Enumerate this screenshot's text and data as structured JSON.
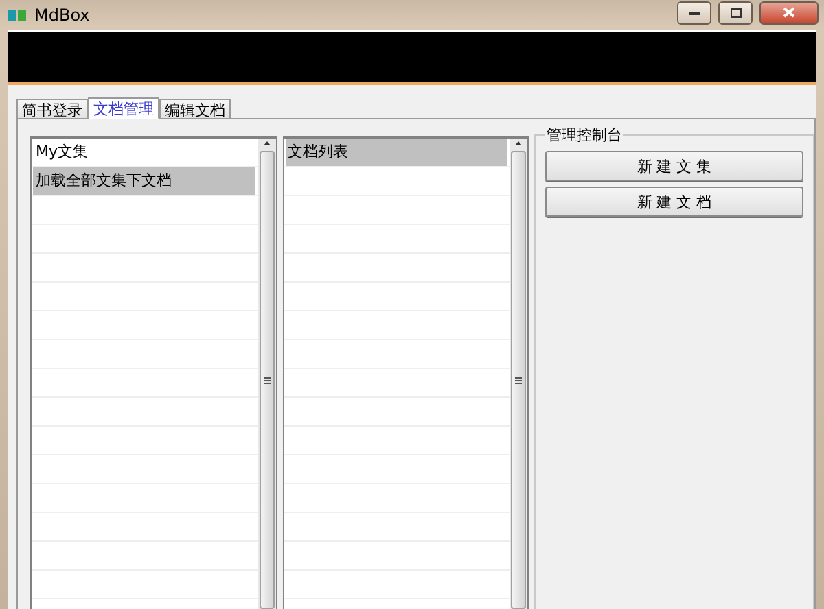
{
  "window": {
    "title": "MdBox"
  },
  "tabs": [
    {
      "label": "简书登录",
      "selected": false
    },
    {
      "label": "文档管理",
      "selected": true
    },
    {
      "label": "编辑文档",
      "selected": false
    }
  ],
  "collections_list": {
    "items": [
      {
        "label": "My文集",
        "selected": false
      },
      {
        "label": "加载全部文集下文档",
        "selected": true
      }
    ]
  },
  "documents_list": {
    "items": [
      {
        "label": "文档列表",
        "selected": true
      }
    ]
  },
  "control_panel": {
    "title": "管理控制台",
    "buttons": [
      "新 建 文 集",
      "新 建 文 档"
    ]
  }
}
